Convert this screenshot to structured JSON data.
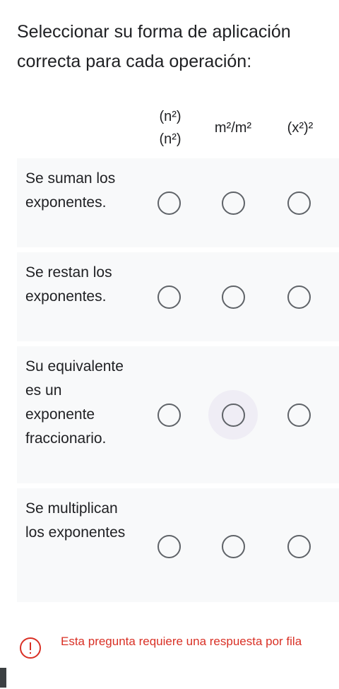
{
  "question": {
    "title": "Seleccionar su forma de aplicación correcta para cada operación:"
  },
  "columns": [
    {
      "line1": "(n²)",
      "line2": "(n²)"
    },
    {
      "label": "m²/m²"
    },
    {
      "label": "(x²)²"
    }
  ],
  "rows": [
    {
      "label": "Se suman los exponentes.",
      "selected": null
    },
    {
      "label": "Se restan los exponentes.",
      "selected": null
    },
    {
      "label": "Su equivalente es un exponente fraccionario.",
      "selected": null
    },
    {
      "label": "Se multiplican los exponentes",
      "selected": null
    }
  ],
  "error": {
    "message": "Esta pregunta requiere una respuesta por fila",
    "icon": "alert-circle-icon",
    "color": "#d93025"
  },
  "colors": {
    "row_background": "#f8f9fa",
    "radio_border": "#5f6368",
    "hover_halo": "#efedf5"
  }
}
